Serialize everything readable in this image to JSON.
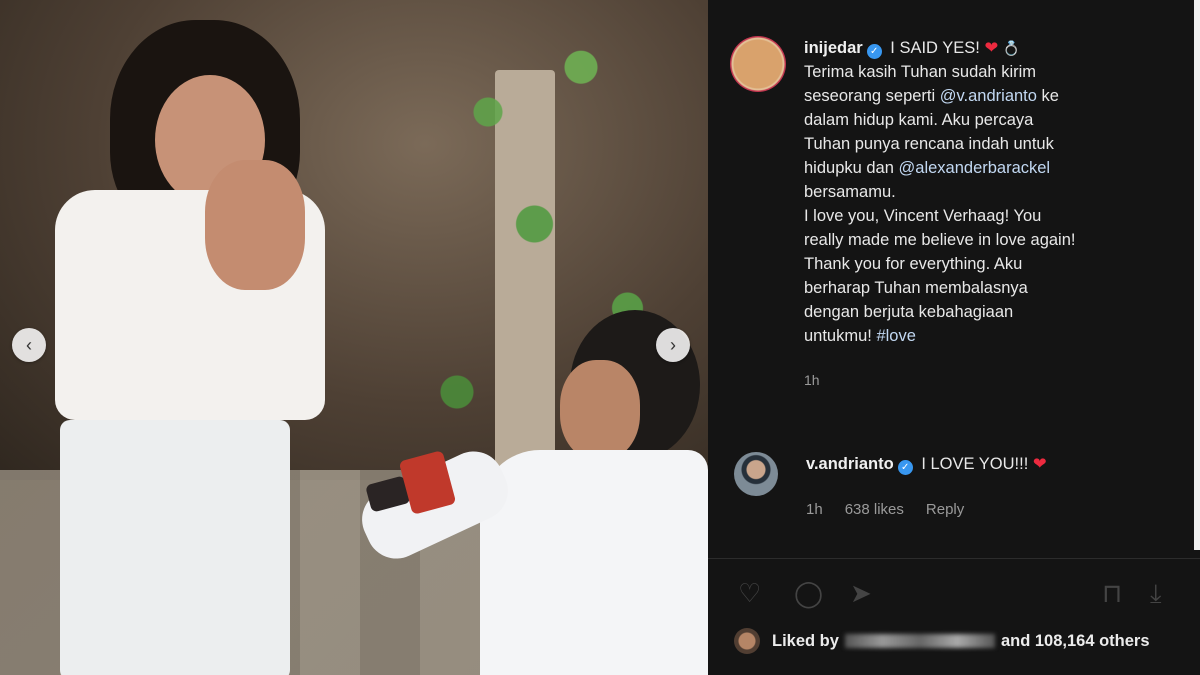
{
  "post": {
    "username": "inijedar",
    "headline": "I SAID YES!",
    "caption_lines": [
      "Terima kasih Tuhan sudah kirim",
      "seseorang seperti",
      "dalam hidup kami. Aku percaya",
      "Tuhan punya rencana indah untuk",
      "hidupku dan",
      "bersamamu.",
      "I love you, Vincent Verhaag! You",
      "really made me believe in love again!",
      "Thank you for everything. Aku",
      "berharap Tuhan membalasnya",
      "dengan berjuta kebahagiaan",
      "untukmu!"
    ],
    "mention_1": "@v.andrianto",
    "mention_1_suffix": " ke",
    "mention_2": "@alexanderbarackel",
    "hashtag": "#love",
    "time": "1h"
  },
  "comment": {
    "username": "v.andrianto",
    "text": "I LOVE YOU!!!",
    "time": "1h",
    "likes": "638 likes",
    "reply": "Reply"
  },
  "likes_bar": {
    "prefix": "Liked by",
    "suffix": "and 108,164 others"
  },
  "icons": {
    "verified": "verified-icon",
    "heart": "heart-icon",
    "ring": "ring-icon",
    "prev": "chevron-left-icon",
    "next": "chevron-right-icon"
  },
  "colors": {
    "panel_bg": "#141414",
    "link": "#c2d8f2",
    "verified": "#3897f0",
    "heart": "#ed2a3f"
  }
}
